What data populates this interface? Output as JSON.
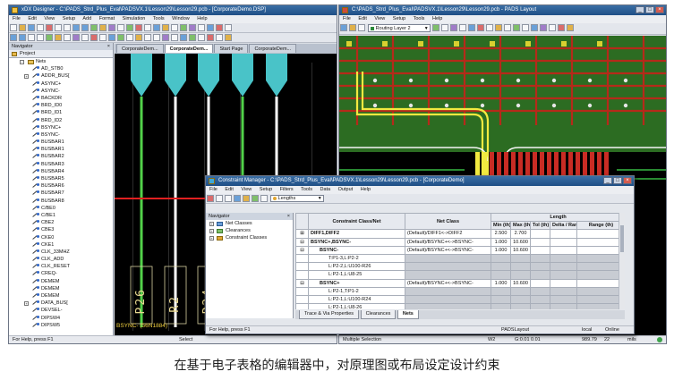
{
  "left_window": {
    "title": "xDX Designer - C:\\PADS_Strd_Plus_Eval\\PADSVX.1\\Lesson29\\Lesson29.pcb - [CorporateDemo.DSP]",
    "menu": [
      "File",
      "Edit",
      "View",
      "Setup",
      "Add",
      "Format",
      "Simulation",
      "Tools",
      "Window",
      "Help"
    ],
    "navigator_title": "Navigator",
    "project_tab": "Project",
    "nets_label": "Nets",
    "nets": [
      "AD_STB0",
      "ADDR_BUS[",
      "ASYNC+",
      "ASYNC-",
      "BACKDR",
      "BRD_ID0",
      "BRD_ID1",
      "BRD_ID2",
      "BSYNC+",
      "BSYNC-",
      "BUSBAR1",
      "BUSBAR1",
      "BUSBAR2",
      "BUSBAR3",
      "BUSBAR4",
      "BUSBAR5",
      "BUSBAR6",
      "BUSBAR7",
      "BUSBAR8",
      "C/BE0",
      "C/BE1",
      "CBE2",
      "CBE3",
      "CKE0",
      "CKE1",
      "CLK_33MHZ",
      "CLK_ADD",
      "CLK_RESET",
      "CREQ-",
      "DEMEM",
      "DEMEM",
      "DEMEM",
      "DATA_BUS[",
      "DEVSEL-",
      "DIPSW4",
      "DIPSW5"
    ],
    "doc_tabs": [
      "CorporateDem...",
      "CorporateDem...",
      "Start Page",
      "CorporateDem..."
    ],
    "schematic_labels": [
      "P26",
      "R2",
      "P24"
    ],
    "net_label": "BSYNC- (56N1884)",
    "status_left": "For Help, press F1",
    "status_mid": "Select"
  },
  "right_window": {
    "title": "C:\\PADS_Strd_Plus_Eval\\PADSVX.1\\Lesson29\\Lesson29.pcb - PADS Layout",
    "menu": [
      "File",
      "Edit",
      "View",
      "Setup",
      "Tools",
      "Help"
    ],
    "layer_select": "Routing Layer 2",
    "status": [
      "Multiple Selection",
      "W2",
      "G:0.01 0.01",
      "989.79",
      "22",
      "mils"
    ]
  },
  "constraint_manager": {
    "title": "Constraint Manager - C:\\PADS_Strd_Plus_Eval\\PADSVX.1\\Lesson29\\Lesson29.pcb - [CorporateDemo]",
    "menu": [
      "File",
      "Edit",
      "View",
      "Setup",
      "Filters",
      "Tools",
      "Data",
      "Output",
      "Help"
    ],
    "toolbar_dropdown": "Lengths",
    "nav_title": "Navigator",
    "nav_items": [
      "Net Classes",
      "Clearances",
      "Constraint Classes"
    ],
    "columns": {
      "class_net": "Constraint Class/Net",
      "net_class": "Net Class",
      "length_group": "Length",
      "min": "Min (th)",
      "max": "Max (th)",
      "tol": "Tol (th)",
      "delta": "Delta / Range (th)",
      "range": "Range (th)"
    },
    "rows": [
      {
        "kind": "class",
        "expand": "⊞",
        "name": "DIFF1,DIFF2",
        "net_class": "(Default)/DIFF1<->DIFF2",
        "min": "2.500",
        "max": "2.700"
      },
      {
        "kind": "class",
        "expand": "⊟",
        "name": "BSYNC+,BSYNC-",
        "net_class": "(Default)/BSYNC+<->BSYNC-",
        "min": "1.000",
        "max": "10.600"
      },
      {
        "kind": "net",
        "expand": "⊟",
        "name": "BSYNC-",
        "net_class": "(Default)/BSYNC+<->BSYNC-",
        "min": "1.000",
        "max": "10.600"
      },
      {
        "kind": "pin",
        "expand": "",
        "name": "T:P1-3,L:P2-2",
        "net_class": "",
        "min": "",
        "max": ""
      },
      {
        "kind": "pin",
        "expand": "",
        "name": "L:P2-2,L:U100-R26",
        "net_class": "",
        "min": "",
        "max": ""
      },
      {
        "kind": "pin",
        "expand": "",
        "name": "L:P2-1,L:U8-25",
        "net_class": "",
        "min": "",
        "max": ""
      },
      {
        "kind": "net",
        "expand": "⊟",
        "name": "BSYNC+",
        "net_class": "(Default)/BSYNC+<->BSYNC-",
        "min": "1.000",
        "max": "10.600"
      },
      {
        "kind": "pin",
        "expand": "",
        "name": "L:P2-1,T:P1-2",
        "net_class": "",
        "min": "",
        "max": ""
      },
      {
        "kind": "pin",
        "expand": "",
        "name": "L:P2-1,L:U100-R24",
        "net_class": "",
        "min": "",
        "max": ""
      },
      {
        "kind": "pin",
        "expand": "",
        "name": "L:P2-1,L:U8-26",
        "net_class": "",
        "min": "",
        "max": ""
      }
    ],
    "bottom_tabs": [
      "Trace & Via Properties",
      "Clearances",
      "Nets"
    ],
    "status": "For Help, press F1",
    "status_right": [
      "PADSLayout",
      "local",
      "Online"
    ]
  },
  "caption": "在基于电子表格的编辑器中，对原理图或布局设定设计约束"
}
